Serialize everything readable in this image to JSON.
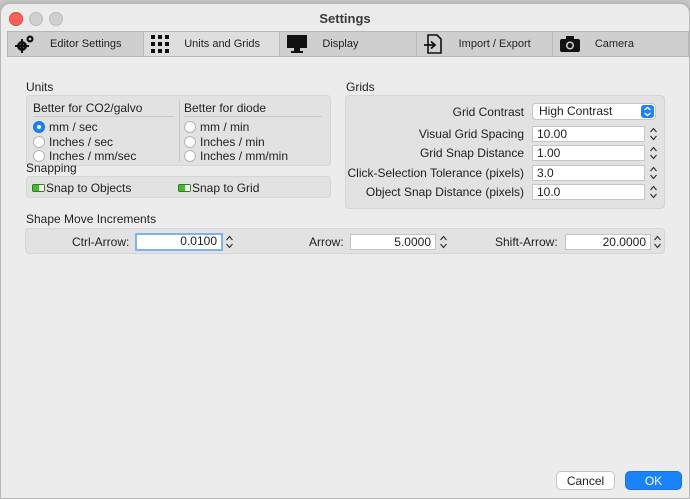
{
  "window": {
    "title": "Settings"
  },
  "tabs": [
    {
      "label": "Editor Settings",
      "icon": "gears-icon"
    },
    {
      "label": "Units and Grids",
      "icon": "grid-icon"
    },
    {
      "label": "Display",
      "icon": "monitor-icon"
    },
    {
      "label": "Import / Export",
      "icon": "import-export-icon"
    },
    {
      "label": "Camera",
      "icon": "camera-icon"
    }
  ],
  "active_tab": "Units and Grids",
  "units": {
    "title": "Units",
    "co2": {
      "heading": "Better for CO2/galvo",
      "options": [
        "mm / sec",
        "Inches / sec",
        "Inches / mm/sec"
      ],
      "selected": "mm / sec"
    },
    "diode": {
      "heading": "Better for diode",
      "options": [
        "mm / min",
        "Inches / min",
        "Inches / mm/min"
      ]
    }
  },
  "snapping": {
    "title": "Snapping",
    "snap_to_objects": "Snap to Objects",
    "snap_to_grid": "Snap to Grid"
  },
  "grids": {
    "title": "Grids",
    "grid_contrast_label": "Grid Contrast",
    "grid_contrast_value": "High Contrast",
    "visual_grid_spacing_label": "Visual Grid Spacing",
    "visual_grid_spacing_value": "10.00",
    "grid_snap_distance_label": "Grid Snap Distance",
    "grid_snap_distance_value": "1.00",
    "click_selection_tolerance_label": "Click-Selection Tolerance (pixels)",
    "click_selection_tolerance_value": "3.0",
    "object_snap_distance_label": "Object Snap Distance (pixels)",
    "object_snap_distance_value": "10.0"
  },
  "shape_move": {
    "title": "Shape Move Increments",
    "ctrl_arrow_label": "Ctrl-Arrow:",
    "ctrl_arrow_value": "0.0100",
    "arrow_label": "Arrow:",
    "arrow_value": "5.0000",
    "shift_arrow_label": "Shift-Arrow:",
    "shift_arrow_value": "20.0000"
  },
  "buttons": {
    "cancel": "Cancel",
    "ok": "OK"
  },
  "colors": {
    "accent": "#1a82fb",
    "toggle_on": "#3fbf27",
    "close": "#ff5f57"
  }
}
